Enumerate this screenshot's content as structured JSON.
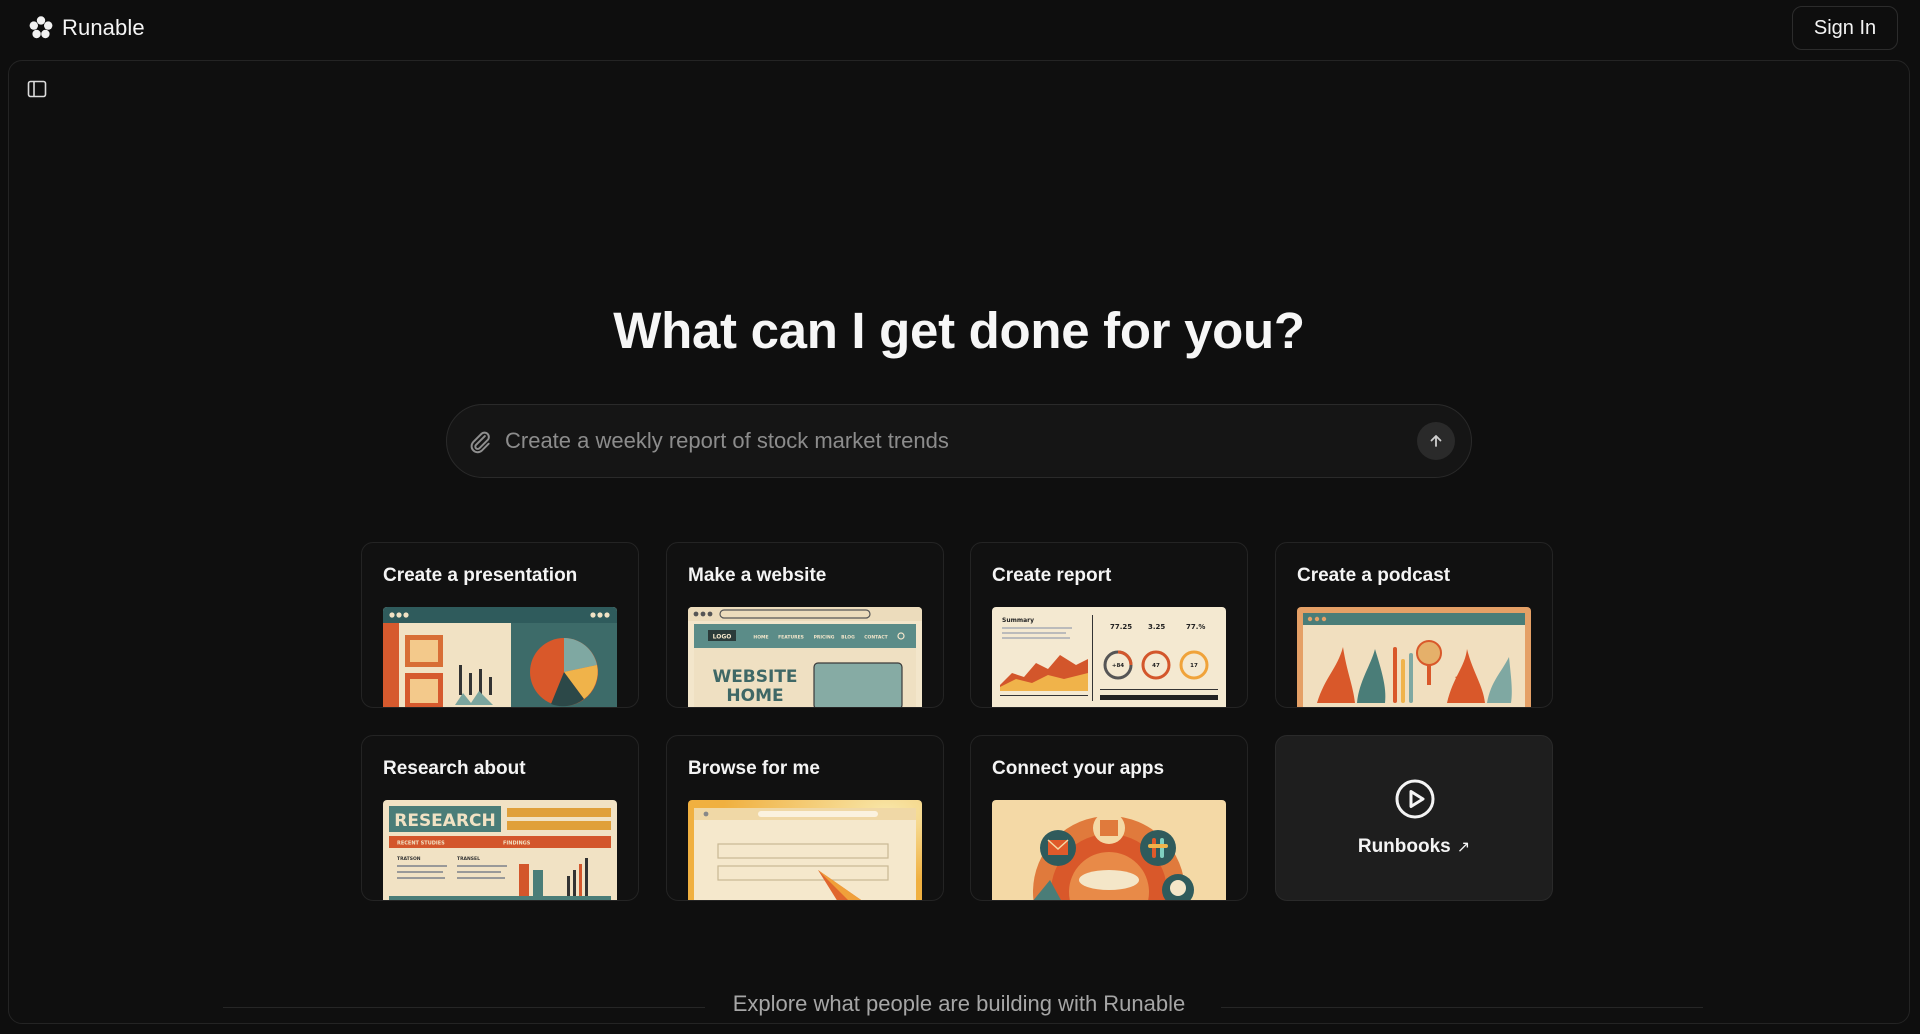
{
  "brand": {
    "name": "Runable",
    "icon": "runable-logo-icon"
  },
  "header": {
    "signin_label": "Sign In"
  },
  "sidebar": {
    "toggle_icon": "sidebar-toggle-icon"
  },
  "hero": {
    "headline": "What can I get done for you?"
  },
  "prompt": {
    "placeholder": "Create a weekly report of stock market trends",
    "attach_icon": "paperclip-icon",
    "send_icon": "arrow-up-icon"
  },
  "cards": [
    {
      "title": "Create a presentation",
      "thumb": "presentation-illustration"
    },
    {
      "title": "Make a website",
      "thumb": "website-illustration",
      "thumb_text": {
        "logo": "LOGO",
        "nav": [
          "HOME",
          "FEATURES",
          "PRICING",
          "BLOG",
          "CONTACT"
        ],
        "hero": [
          "WEBSITE",
          "HOME"
        ]
      }
    },
    {
      "title": "Create report",
      "thumb": "report-illustration",
      "thumb_text": {
        "heading": "Summary",
        "stats": [
          "77.25",
          "3.25",
          "77.%"
        ],
        "gauges": [
          "+84",
          "47",
          "17"
        ]
      }
    },
    {
      "title": "Create a podcast",
      "thumb": "podcast-illustration"
    },
    {
      "title": "Research about",
      "thumb": "research-illustration",
      "thumb_text": {
        "banner": "RESEARCH",
        "row1": "RECENT STUDIES",
        "row2": "FINDINGS",
        "cols": [
          "TRATSON",
          "TRANSEL"
        ]
      }
    },
    {
      "title": "Browse for me",
      "thumb": "browser-illustration"
    },
    {
      "title": "Connect your apps",
      "thumb": "apps-illustration"
    }
  ],
  "runbooks": {
    "label": "Runbooks",
    "icon": "play-circle-icon",
    "arrow": "↗"
  },
  "explore": {
    "text": "Explore what people are building with Runable"
  },
  "colors": {
    "background": "#0e0e0e",
    "panel": "#0f0f0f",
    "card": "#111111",
    "runbooks_card": "#1e1e1e",
    "accent_orange": "#e0662e",
    "accent_teal": "#4a8c88",
    "cream": "#f4e6c8"
  }
}
